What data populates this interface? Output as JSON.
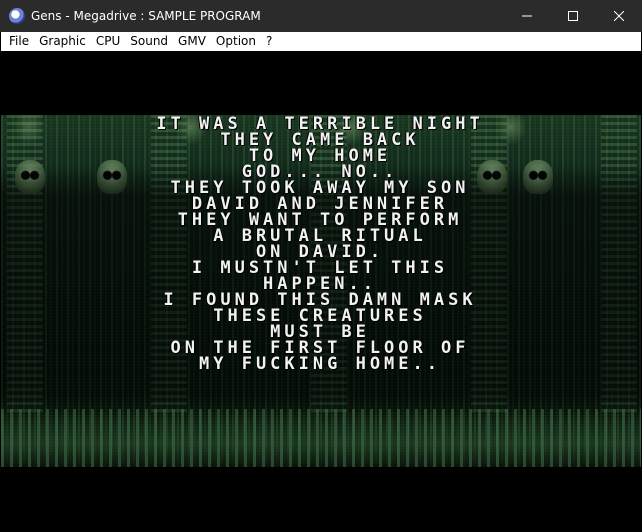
{
  "window": {
    "title": "Gens - Megadrive : SAMPLE PROGRAM",
    "icon": "gens-app-icon",
    "controls": [
      "minimize-icon",
      "maximize-icon",
      "close-icon"
    ]
  },
  "menubar": {
    "items": [
      "File",
      "Graphic",
      "CPU",
      "Sound",
      "GMV",
      "Option",
      "?"
    ]
  },
  "game": {
    "lines": [
      "IT WAS A TERRIBLE NIGHT",
      "THEY CAME BACK",
      "TO MY HOME",
      "GOD... NO..",
      "THEY TOOK AWAY MY SON",
      "DAVID AND JENNIFER",
      "THEY WANT TO PERFORM",
      "A BRUTAL RITUAL",
      "ON DAVID.",
      "I MUSTN'T LET THIS",
      "HAPPEN..",
      "I FOUND THIS DAMN MASK",
      "THESE CREATURES",
      "MUST BE",
      "ON THE FIRST FLOOR OF",
      "MY FUCKING HOME.."
    ]
  },
  "colors": {
    "titlebar": "#2b2b2b",
    "menubar": "#ffffff",
    "screen_background": "#000000",
    "text": "#f2f2f2",
    "scene_green": "#1b3a22"
  }
}
